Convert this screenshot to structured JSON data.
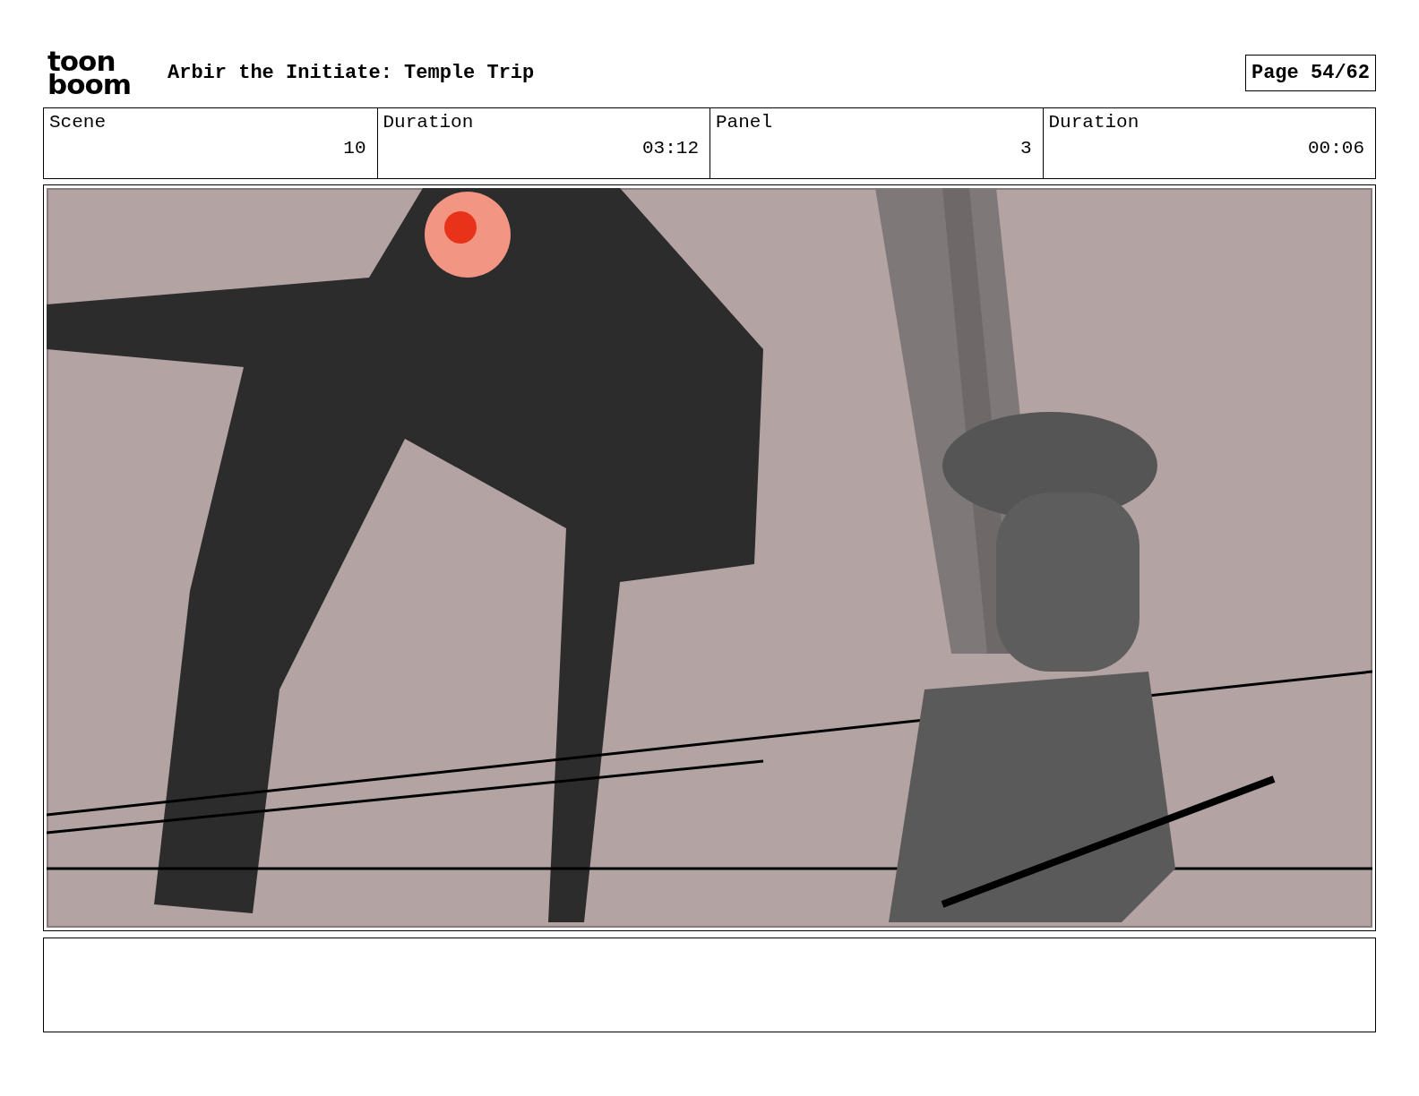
{
  "logo": [
    "toon",
    "boom"
  ],
  "title": "Arbir the Initiate: Temple Trip",
  "page": "Page 54/62",
  "fields": [
    {
      "label": "Scene",
      "value": "10"
    },
    {
      "label": "Duration",
      "value": "03:12"
    },
    {
      "label": "Panel",
      "value": "3"
    },
    {
      "label": "Duration",
      "value": "00:06"
    }
  ]
}
